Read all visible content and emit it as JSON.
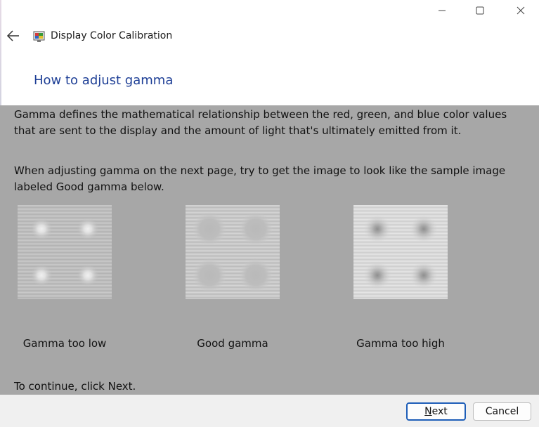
{
  "window": {
    "title": "Display Color Calibration",
    "controls": [
      "minimize-icon",
      "maximize-icon",
      "close-icon"
    ]
  },
  "page": {
    "heading": "How to adjust gamma",
    "paragraph1": "Gamma defines the mathematical relationship between the red, green, and blue color values that are sent to the display and the amount of light that's ultimately emitted from it.",
    "paragraph2": "When adjusting gamma on the next page, try to get the image to look like the sample image labeled Good gamma below.",
    "samples": [
      {
        "label": "Gamma too low",
        "style": "low"
      },
      {
        "label": "Good gamma",
        "style": "good"
      },
      {
        "label": "Gamma too high",
        "style": "high"
      }
    ],
    "continue_text": "To continue, click Next."
  },
  "footer": {
    "next_label_underlined": "N",
    "next_label_rest": "ext",
    "cancel_label": "Cancel"
  },
  "colors": {
    "heading": "#1e3f96",
    "content_bg": "#a7a7a7",
    "primary_border": "#1e5eb8"
  }
}
